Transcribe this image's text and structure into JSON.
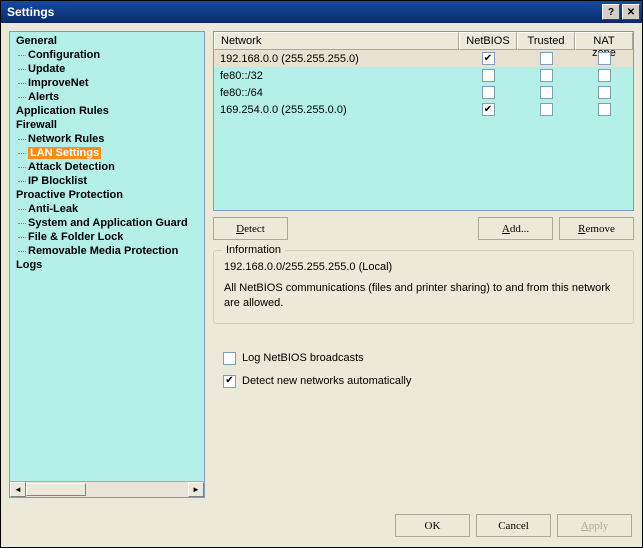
{
  "window": {
    "title": "Settings"
  },
  "tree": {
    "items": [
      {
        "label": "General",
        "type": "root"
      },
      {
        "label": "Configuration",
        "type": "child"
      },
      {
        "label": "Update",
        "type": "child"
      },
      {
        "label": "ImproveNet",
        "type": "child"
      },
      {
        "label": "Alerts",
        "type": "child"
      },
      {
        "label": "Application Rules",
        "type": "root"
      },
      {
        "label": "Firewall",
        "type": "root"
      },
      {
        "label": "Network Rules",
        "type": "child"
      },
      {
        "label": "LAN Settings",
        "type": "child",
        "selected": true
      },
      {
        "label": "Attack Detection",
        "type": "child"
      },
      {
        "label": "IP Blocklist",
        "type": "child"
      },
      {
        "label": "Proactive Protection",
        "type": "root"
      },
      {
        "label": "Anti-Leak",
        "type": "child"
      },
      {
        "label": "System and Application Guard",
        "type": "child"
      },
      {
        "label": "File & Folder Lock",
        "type": "child"
      },
      {
        "label": "Removable Media Protection",
        "type": "child"
      },
      {
        "label": "Logs",
        "type": "root"
      }
    ]
  },
  "table": {
    "headers": {
      "network": "Network",
      "netbios": "NetBIOS",
      "trusted": "Trusted",
      "natzone": "NAT zone"
    },
    "rows": [
      {
        "network": "192.168.0.0 (255.255.255.0)",
        "netbios": true,
        "trusted": false,
        "natzone": false,
        "selected": true
      },
      {
        "network": "fe80::/32",
        "netbios": false,
        "trusted": false,
        "natzone": false
      },
      {
        "network": "fe80::/64",
        "netbios": false,
        "trusted": false,
        "natzone": false
      },
      {
        "network": "169.254.0.0 (255.255.0.0)",
        "netbios": true,
        "trusted": false,
        "natzone": false
      }
    ]
  },
  "buttons": {
    "detect": "Detect",
    "add": "Add...",
    "remove": "Remove",
    "ok": "OK",
    "cancel": "Cancel",
    "apply": "Apply"
  },
  "info": {
    "title": "Information",
    "network": "192.168.0.0/255.255.255.0 (Local)",
    "description": "All NetBIOS communications (files and printer sharing) to and from this network are allowed."
  },
  "options": {
    "log_label": "Log NetBIOS broadcasts",
    "log_checked": false,
    "detect_label": "Detect new networks automatically",
    "detect_checked": true
  }
}
